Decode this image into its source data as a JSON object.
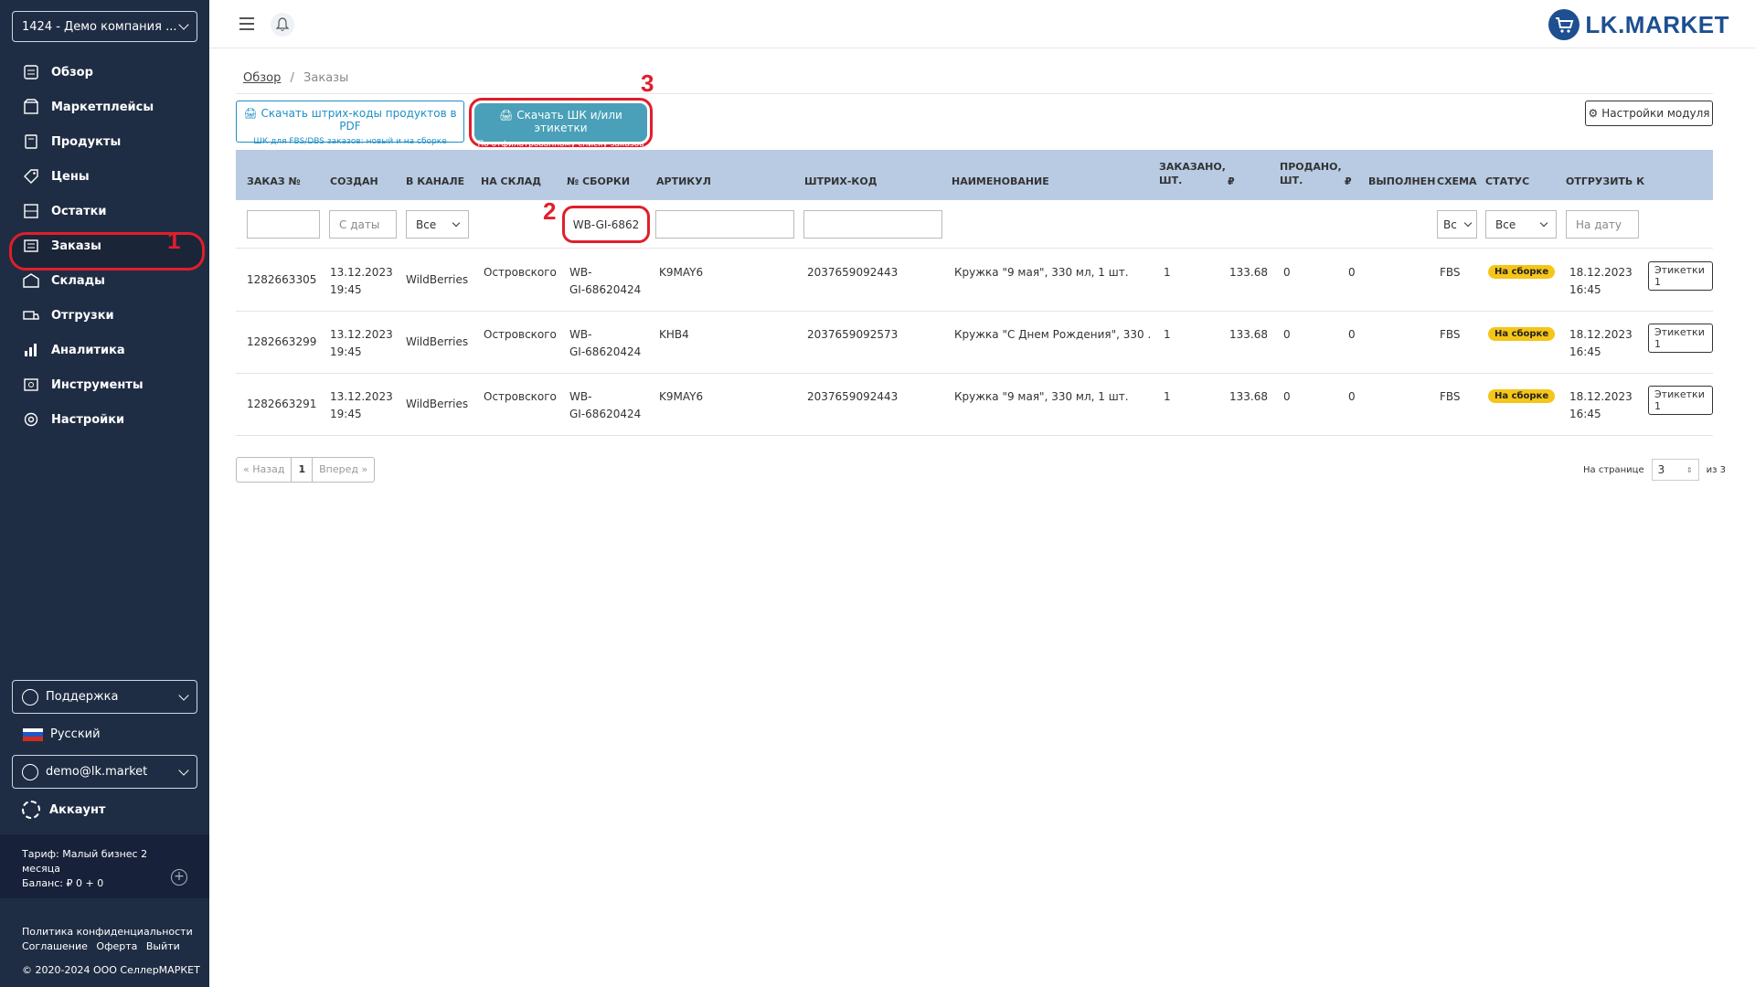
{
  "sidebar": {
    "company": "1424 - Демо компания ...",
    "items": [
      {
        "label": "Обзор",
        "icon": "overview-icon"
      },
      {
        "label": "Маркетплейсы",
        "icon": "marketplaces-icon"
      },
      {
        "label": "Продукты",
        "icon": "products-icon"
      },
      {
        "label": "Цены",
        "icon": "prices-icon"
      },
      {
        "label": "Остатки",
        "icon": "stock-icon"
      },
      {
        "label": "Заказы",
        "icon": "orders-icon"
      },
      {
        "label": "Склады",
        "icon": "warehouses-icon"
      },
      {
        "label": "Отгрузки",
        "icon": "shipments-icon"
      },
      {
        "label": "Аналитика",
        "icon": "analytics-icon"
      },
      {
        "label": "Инструменты",
        "icon": "tools-icon"
      },
      {
        "label": "Настройки",
        "icon": "settings-icon"
      }
    ],
    "support": "Поддержка",
    "language": "Русский",
    "user": "demo@lk.market",
    "account": "Аккаунт",
    "tariff_line1": "Тариф: Малый бизнес 2",
    "tariff_line2": "месяца",
    "balance": "Баланс: ₽ 0 + 0",
    "links": {
      "privacy": "Политика конфиденциальности",
      "agreement": "Соглашение",
      "offer": "Оферта",
      "logout": "Выйти"
    },
    "copyright": "© 2020-2024 ООО СеллерМАРКЕТ"
  },
  "markers": {
    "m1": "1",
    "m2": "2",
    "m3": "3"
  },
  "topbar": {
    "logo": "LK.MARKET"
  },
  "breadcrumb": {
    "home": "Обзор",
    "sep": "/",
    "current": "Заказы"
  },
  "buttons": {
    "pdf_line1": "Скачать штрих-коды продуктов в PDF",
    "pdf_line2": "ШК для FBS/DBS заказов: новый и на сборке",
    "shk_line1": "Скачать ШК и/или этикетки",
    "shk_line2": "По отфильтрованному списку заказов",
    "settings": "Настройки модуля"
  },
  "table": {
    "headers": {
      "order": "ЗАКАЗ №",
      "created": "СОЗДАН",
      "channel": "В КАНАЛЕ",
      "warehouse": "НА СКЛАД",
      "assembly": "№ СБОРКИ",
      "article": "АРТИКУЛ",
      "barcode": "ШТРИХ-КОД",
      "name": "НАИМЕНОВАНИЕ",
      "ordered1": "ЗАКАЗАНО,",
      "ordered2": "ШТ.",
      "rub1": "₽",
      "sold1": "ПРОДАНО,",
      "sold2": "ШТ.",
      "rub2": "₽",
      "done": "ВЫПОЛНЕН",
      "scheme": "СХЕМА",
      "status": "СТАТУС",
      "ship": "ОТГРУЗИТЬ К"
    },
    "filters": {
      "date_placeholder": "С даты",
      "channel": "Все",
      "assembly_value": "WB-GI-6862",
      "scheme": "Вс",
      "status": "Все",
      "ship_placeholder": "На дату"
    },
    "rows": [
      {
        "order": "1282663305",
        "date": "13.12.2023",
        "time": "19:45",
        "channel": "WildBerries",
        "warehouse": "Островского",
        "asm1": "WB-",
        "asm2": "GI-68620424",
        "article": "K9MAY6",
        "barcode": "2037659092443",
        "name": "Кружка \"9 мая\", 330 мл, 1 шт.",
        "ordered": "1",
        "price": "133.68",
        "sold": "0",
        "sold_rub": "0",
        "scheme": "FBS",
        "status": "На сборке",
        "ship_date": "18.12.2023",
        "ship_time": "16:45",
        "labels": "Этикетки 1"
      },
      {
        "order": "1282663299",
        "date": "13.12.2023",
        "time": "19:45",
        "channel": "WildBerries",
        "warehouse": "Островского",
        "asm1": "WB-",
        "asm2": "GI-68620424",
        "article": "KHB4",
        "barcode": "2037659092573",
        "name": "Кружка \"С Днем Рождения\", 330 ...",
        "ordered": "1",
        "price": "133.68",
        "sold": "0",
        "sold_rub": "0",
        "scheme": "FBS",
        "status": "На сборке",
        "ship_date": "18.12.2023",
        "ship_time": "16:45",
        "labels": "Этикетки 1"
      },
      {
        "order": "1282663291",
        "date": "13.12.2023",
        "time": "19:45",
        "channel": "WildBerries",
        "warehouse": "Островского",
        "asm1": "WB-",
        "asm2": "GI-68620424",
        "article": "K9MAY6",
        "barcode": "2037659092443",
        "name": "Кружка \"9 мая\", 330 мл, 1 шт.",
        "ordered": "1",
        "price": "133.68",
        "sold": "0",
        "sold_rub": "0",
        "scheme": "FBS",
        "status": "На сборке",
        "ship_date": "18.12.2023",
        "ship_time": "16:45",
        "labels": "Этикетки 1"
      }
    ]
  },
  "pager": {
    "prev": "« Назад",
    "page": "1",
    "next": "Вперед »",
    "per_page_label": "На странице",
    "per_page_value": "3",
    "of_total": "из 3"
  },
  "colors": {
    "sidebar": "#1f2d44",
    "accent": "#1e8fc6",
    "header": "#b8cbe3",
    "badge": "#f5c518",
    "highlight": "#e01e2a"
  }
}
